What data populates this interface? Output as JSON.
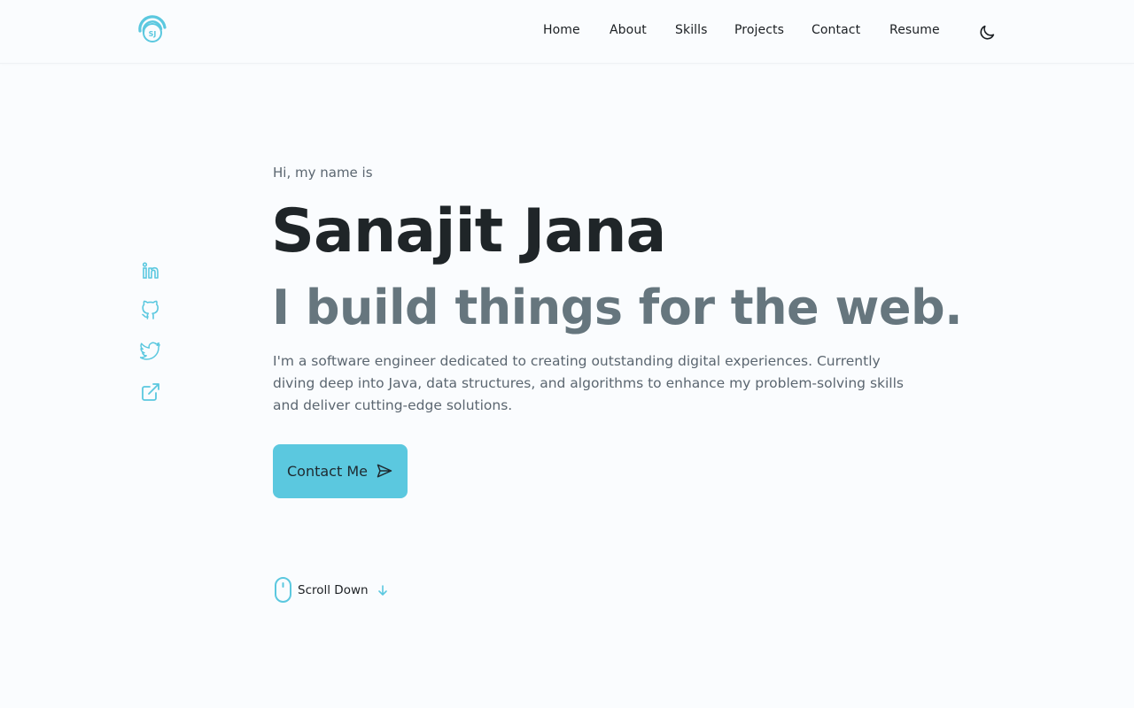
{
  "brand": {
    "logo_initials": "SJ",
    "accent_color": "#5bc8df"
  },
  "nav": {
    "items": [
      {
        "label": "Home"
      },
      {
        "label": "About"
      },
      {
        "label": "Skills"
      },
      {
        "label": "Projects"
      },
      {
        "label": "Contact"
      },
      {
        "label": "Resume"
      }
    ],
    "theme_toggle_icon": "moon-icon"
  },
  "social": {
    "icons": [
      "linkedin-icon",
      "github-icon",
      "twitter-icon",
      "external-link-icon"
    ]
  },
  "hero": {
    "greeting": "Hi, my name is",
    "name": "Sanajit Jana",
    "tagline": "I build things for the web.",
    "intro": "I'm a software engineer dedicated to creating outstanding digital experiences. Currently diving deep into Java, data structures, and algorithms to enhance my problem-solving skills and deliver cutting-edge solutions.",
    "cta_label": "Contact Me",
    "cta_icon": "send-icon"
  },
  "scroll": {
    "label": "Scroll Down",
    "icons": [
      "mouse-icon",
      "arrow-down-icon"
    ]
  },
  "colors": {
    "background": "#fafcfe",
    "name_text": "#1f2528",
    "tagline_text": "#66767e",
    "body_text": "#5b6670"
  }
}
